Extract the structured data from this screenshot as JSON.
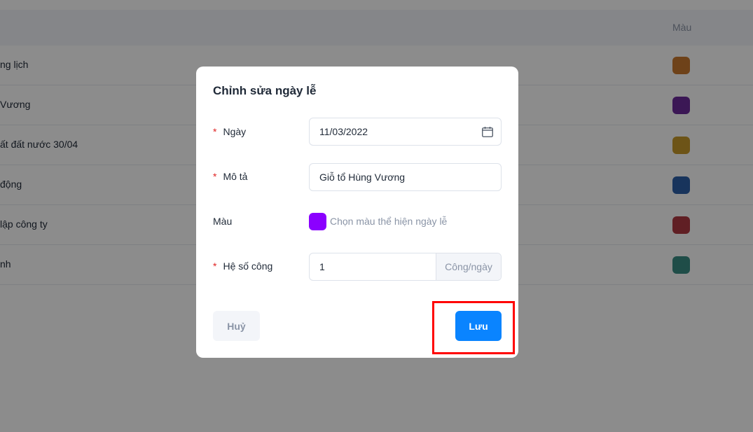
{
  "table": {
    "header": {
      "color_col": "Màu"
    },
    "rows": [
      {
        "description": "ng lịch",
        "color": "#c9782e"
      },
      {
        "description": "Vương",
        "color": "#6c2b9b"
      },
      {
        "description": "ất đất nước 30/04",
        "color": "#c7992a"
      },
      {
        "description": "động",
        "color": "#2d5fa8"
      },
      {
        "description": "lập công ty",
        "color": "#b03a43"
      },
      {
        "description": "nh",
        "color": "#3a8c84"
      }
    ]
  },
  "modal": {
    "title": "Chỉnh sửa ngày lễ",
    "fields": {
      "date": {
        "required_mark": "*",
        "label": "Ngày",
        "value": "11/03/2022",
        "icon": "calendar-icon"
      },
      "description": {
        "required_mark": "*",
        "label": "Mô tả",
        "value": "Giỗ tổ Hùng Vương"
      },
      "color": {
        "label": "Màu",
        "value": "#8b00ff",
        "hint": "Chọn màu thể hiện ngày lễ"
      },
      "coefficient": {
        "required_mark": "*",
        "label": "Hệ số công",
        "value": "1",
        "unit": "Công/ngày"
      }
    },
    "buttons": {
      "cancel": "Huỷ",
      "save": "Lưu"
    }
  },
  "colors": {
    "primary": "#0a84ff",
    "required": "#e02424",
    "highlight": "#ff0000"
  }
}
